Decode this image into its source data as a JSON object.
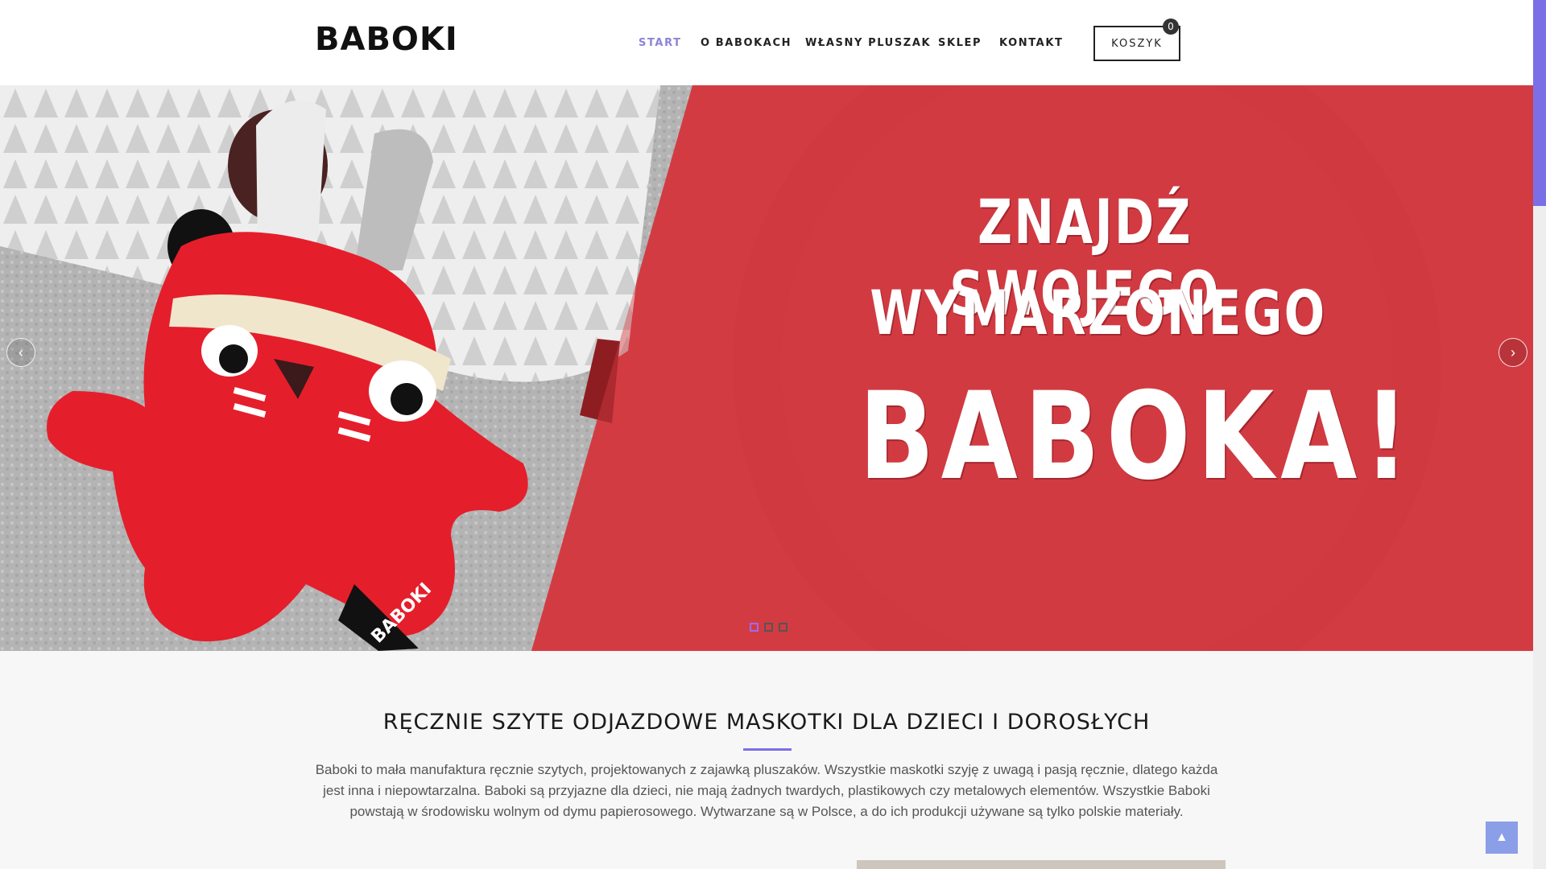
{
  "header": {
    "logo": "BABOKI",
    "nav": [
      {
        "label": "START",
        "active": true
      },
      {
        "label": "O BABOKACH",
        "active": false
      },
      {
        "label": "WŁASNY PLUSZAK",
        "active": false
      },
      {
        "label": "SKLEP",
        "active": false
      },
      {
        "label": "KONTAKT",
        "active": false
      }
    ],
    "cart": {
      "label": "KOSZYK",
      "count": "0"
    }
  },
  "hero": {
    "line1": "ZNAJDŹ SWOJEGO",
    "line2": "WYMARZONEGO",
    "line3": "BABOKA!",
    "toy_tag": "BABOKI",
    "slides_total": 3,
    "active_slide": 1
  },
  "intro": {
    "title": "RĘCZNIE SZYTE ODJAZDOWE MASKOTKI DLA DZIECI I DOROSŁYCH",
    "text": "Baboki to mała manufaktura ręcznie szytych, projektowanych z zajawką pluszaków. Wszystkie maskotki szyję z uwagą i pasją ręcznie, dlatego każda jest inna i niepowtarzalna. Baboki są przyjazne dla dzieci, nie mają żadnych twardych, plastikowych czy metalowych elementów. Wszystkie Baboki powstają w środowisku wolnym od dymu papierosowego. Wytwarzane są w Polsce, a do ich produkcji używane są tylko polskie materiały."
  },
  "colors": {
    "accent": "#7b6fe6",
    "hero_red": "#d33b43",
    "nav_active": "#8b83d8"
  },
  "icons": {
    "prev": "chevron-left-icon",
    "next": "chevron-right-icon",
    "top": "chevron-up-icon"
  }
}
